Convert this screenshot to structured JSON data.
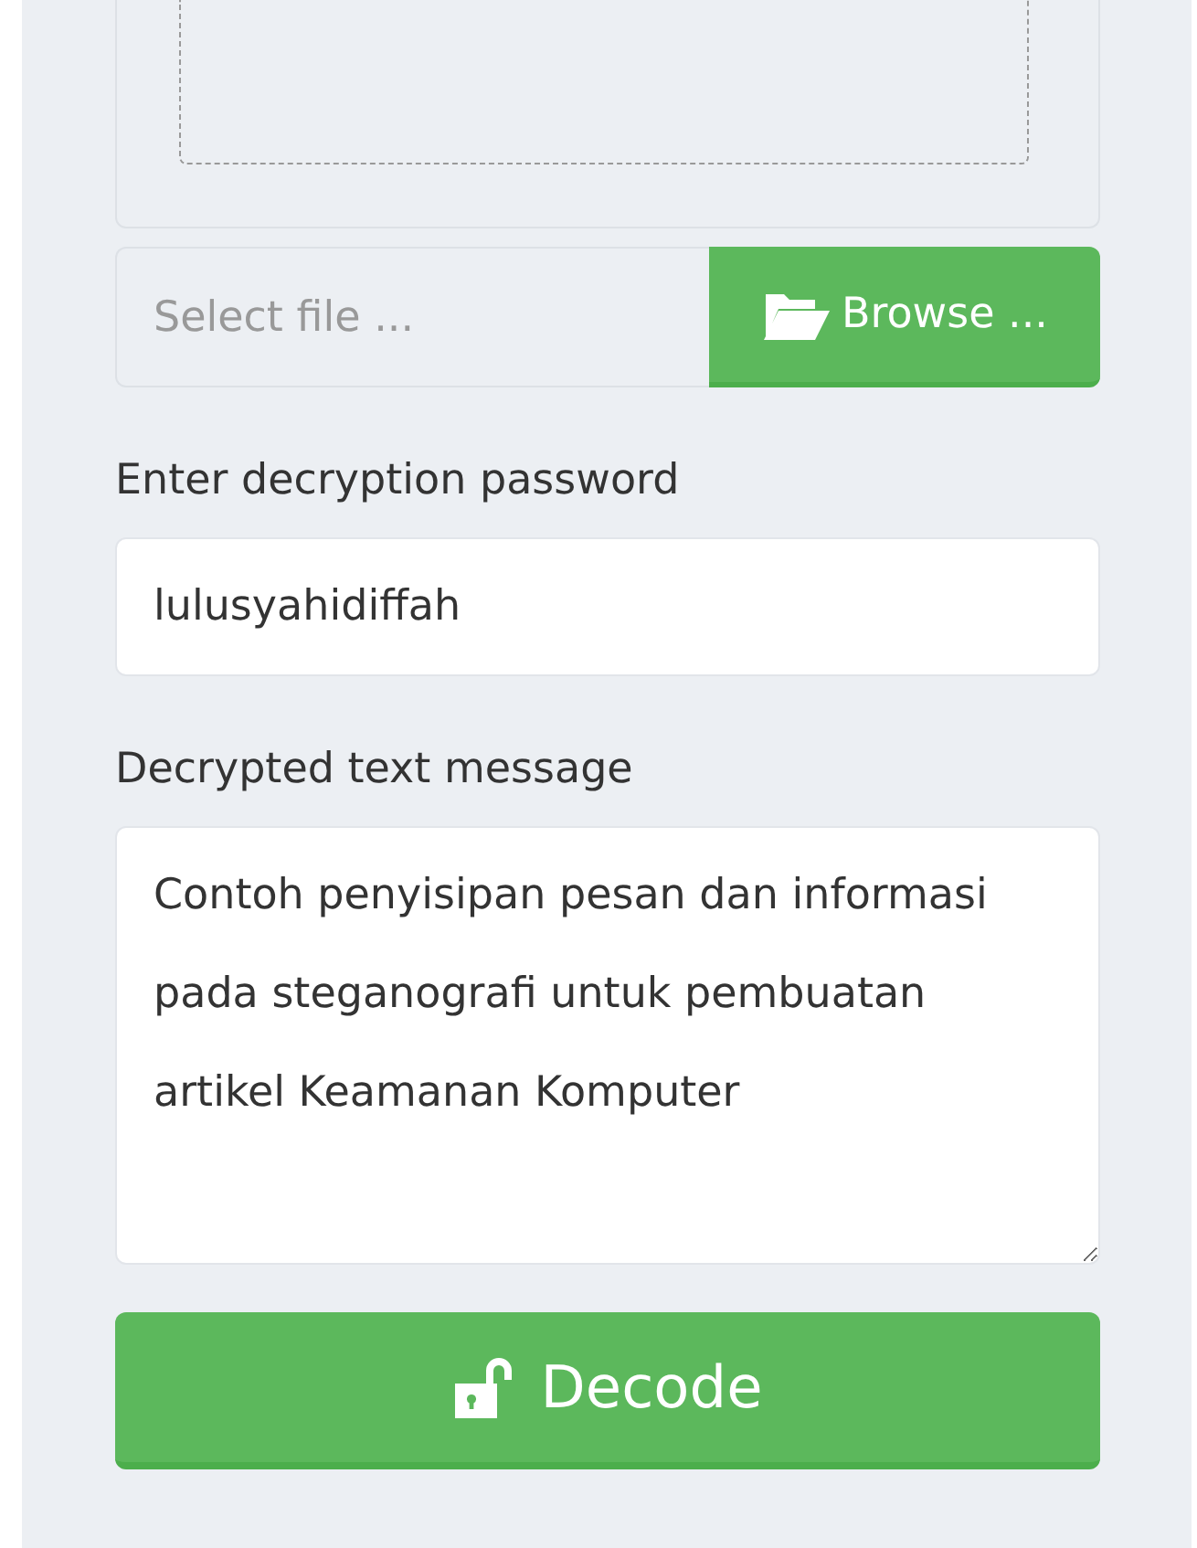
{
  "file_input": {
    "placeholder": "Select file ...",
    "button": "Browse ..."
  },
  "password": {
    "label": "Enter decryption password",
    "value": "lulusyahidiffah"
  },
  "message": {
    "label": "Decrypted text message",
    "value": "Contoh penyisipan pesan dan informasi pada steganografi untuk pembuatan artikel Keamanan Komputer"
  },
  "decode_button": "Decode"
}
